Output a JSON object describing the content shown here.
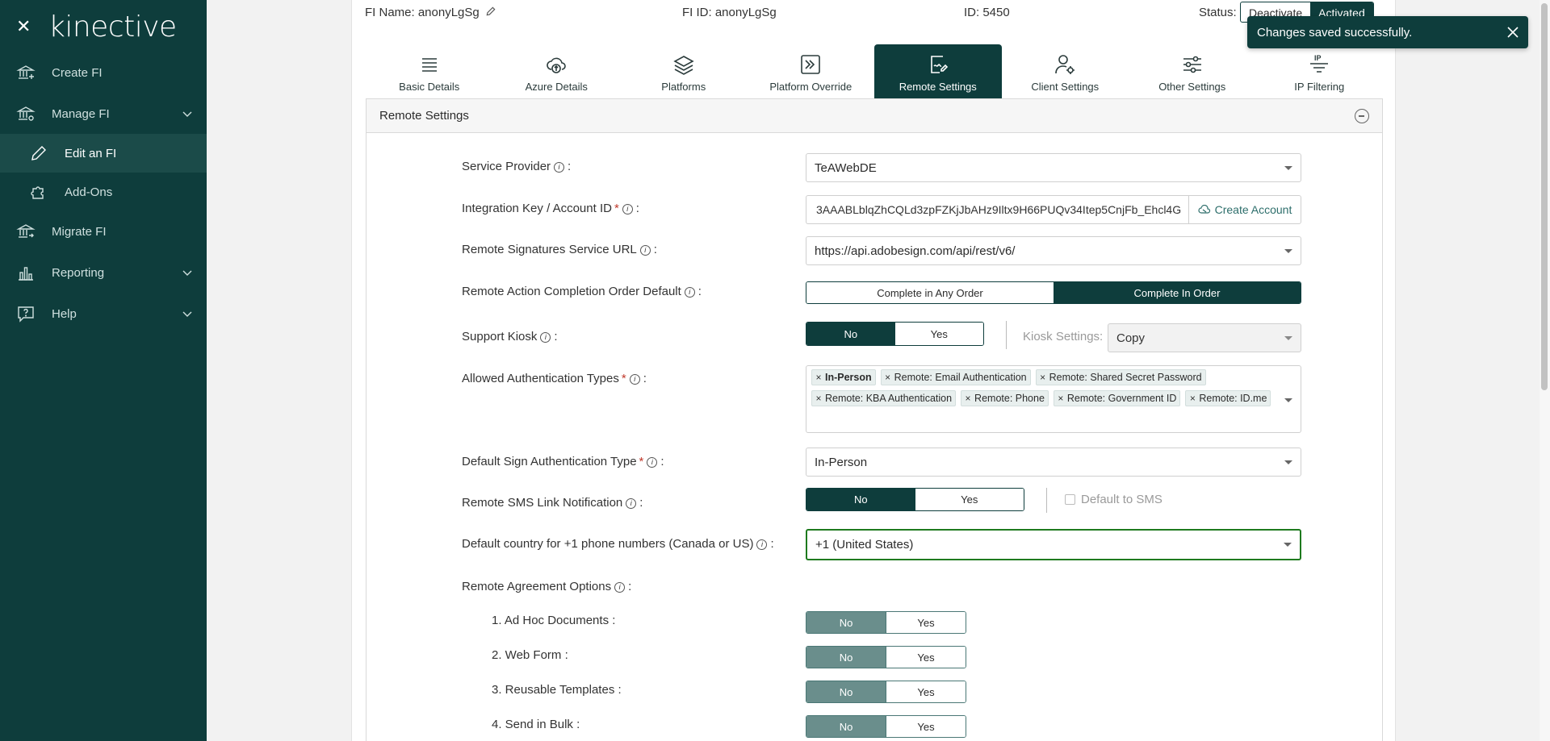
{
  "sidebar": {
    "logo": "kinective",
    "items": [
      {
        "label": "Create FI",
        "icon": "bank-plus-icon"
      },
      {
        "label": "Manage FI",
        "icon": "bank-gear-icon"
      },
      {
        "label": "Edit an FI",
        "icon": "pencil-icon"
      },
      {
        "label": "Add-Ons",
        "icon": "puzzle-icon"
      },
      {
        "label": "Migrate FI",
        "icon": "bank-arrow-icon"
      },
      {
        "label": "Reporting",
        "icon": "bar-chart-icon"
      },
      {
        "label": "Help",
        "icon": "help-bubble-icon"
      }
    ]
  },
  "header": {
    "fi_name": "FI Name: anonyLgSg",
    "fi_id": "FI ID: anonyLgSg",
    "id": "ID: 5450",
    "status_label": "Status:",
    "deactivate": "Deactivate",
    "activated": "Activated"
  },
  "tabs": [
    {
      "label": "Basic Details",
      "icon": "list-icon"
    },
    {
      "label": "Azure Details",
      "icon": "cloud-upload-icon"
    },
    {
      "label": "Platforms",
      "icon": "layers-icon"
    },
    {
      "label": "Platform Override",
      "icon": "override-icon"
    },
    {
      "label": "Remote Settings",
      "icon": "remote-sign-icon"
    },
    {
      "label": "Client Settings",
      "icon": "user-gear-icon"
    },
    {
      "label": "Other Settings",
      "icon": "sliders-icon"
    },
    {
      "label": "IP Filtering",
      "icon": "ip-filter-icon"
    }
  ],
  "active_tab": "Remote Settings",
  "panel": {
    "title": "Remote Settings",
    "service_provider": {
      "label": "Service Provider",
      "value": "TeAWebDE"
    },
    "integration_key": {
      "label": "Integration Key / Account ID",
      "value": "3AAABLblqZhCQLd3zpFZKjJbAHz9Iltx9H66PUQv34Itep5CnjFb_Ehcl4G",
      "button": "Create Account"
    },
    "service_url": {
      "label": "Remote Signatures Service URL",
      "value": "https://api.adobesign.com/api/rest/v6/"
    },
    "completion_order": {
      "label": "Remote Action Completion Order Default",
      "options": [
        "Complete in Any Order",
        "Complete In Order"
      ],
      "selected": "Complete In Order"
    },
    "support_kiosk": {
      "label": "Support Kiosk",
      "options": [
        "No",
        "Yes"
      ],
      "selected": "No",
      "kiosk_label": "Kiosk Settings:",
      "kiosk_value": "Copy"
    },
    "auth_types": {
      "label": "Allowed Authentication Types",
      "chips": [
        "In-Person",
        "Remote: Email Authentication",
        "Remote: Shared Secret Password",
        "Remote: KBA Authentication",
        "Remote: Phone",
        "Remote: Government ID",
        "Remote: ID.me"
      ]
    },
    "default_auth": {
      "label": "Default Sign Authentication Type",
      "value": "In-Person"
    },
    "sms_link": {
      "label": "Remote SMS Link Notification",
      "options": [
        "No",
        "Yes"
      ],
      "selected": "No",
      "checkbox_label": "Default to SMS"
    },
    "default_country": {
      "label": "Default country for +1 phone numbers (Canada or US)",
      "value": "+1 (United States)"
    },
    "agreement_options": {
      "label": "Remote Agreement Options",
      "items": [
        {
          "label": "1. Ad Hoc Documents :",
          "selected": "No"
        },
        {
          "label": "2. Web Form :",
          "selected": "No"
        },
        {
          "label": "3. Reusable Templates :",
          "selected": "No"
        },
        {
          "label": "4. Send in Bulk :",
          "selected": "No"
        }
      ],
      "no": "No",
      "yes": "Yes"
    }
  },
  "toast": {
    "message": "Changes saved successfully."
  },
  "colors": {
    "brand": "#0e3d3c",
    "focus": "#1e7a1e",
    "required": "#c0392b"
  }
}
